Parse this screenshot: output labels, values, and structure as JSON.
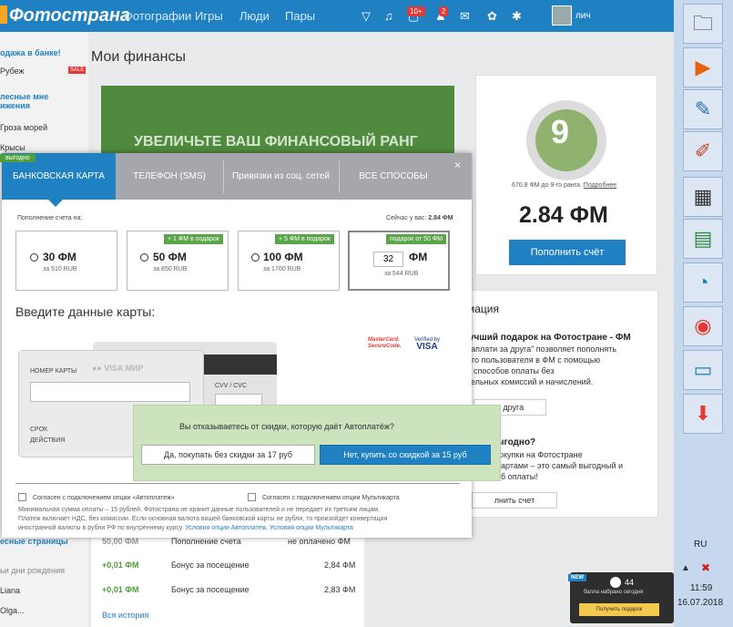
{
  "topbar": {
    "brand": "Фотострана",
    "nav": [
      "Фотографии",
      "Игры",
      "Люди",
      "Пары"
    ],
    "badge_counter": "10+",
    "badge_friends": "2",
    "user_name": "лич"
  },
  "sidebar": {
    "items": [
      "одажа в банке!",
      "Рубеж",
      "лесные мне",
      "ижения",
      "Гроза морей",
      "Крысы",
      "есные страницы",
      "ьи дни рождения",
      "Liana",
      "Olga..."
    ],
    "sale_label": "SALE"
  },
  "page": {
    "title": "Мои финансы",
    "banner_text": "УВЕЛИЧЬТЕ ВАШ ФИНАНСОВЫЙ РАНГ",
    "rank_number": "9",
    "rank_sub": "670.8 ФМ до 9-го ранга.",
    "rank_link": "Подробнее",
    "balance": "2.84 ФМ",
    "topup_button": "Пополнить счёт"
  },
  "info": {
    "title": "мация",
    "gift_title": "учший подарок на Фотостране - ФМ",
    "gift_text_1": "заплати за друга\" позволяет пополнять",
    "gift_text_2": "ого пользователя в ФМ с помощью",
    "gift_text_3": "х способов оплаты без",
    "gift_text_4": "тельных комиссий и начислений.",
    "gift_button": "а друга",
    "q_title": "ыгодно?",
    "q_text_1": "окупки на Фотостране",
    "q_text_2": "артами – это самый выгодный и",
    "q_text_3": "б оплаты!",
    "q_button": "лнить счет"
  },
  "history": {
    "rows": [
      {
        "amount": "50,00 ФМ",
        "desc": "Пополнение счета",
        "status": "не оплачено ФМ"
      },
      {
        "amount": "+0,01 ФМ",
        "desc": "Бонус за посещение",
        "status": "2,84 ФМ"
      },
      {
        "amount": "+0,01 ФМ",
        "desc": "Бонус за посещение",
        "status": "2,83 ФМ"
      }
    ],
    "all_link": "Вся история"
  },
  "modal": {
    "tag": "выгодно",
    "tabs": [
      "БАНКОВСКАЯ КАРТА",
      "ТЕЛЕФОН (SMS)",
      "Привязки из соц. сетей",
      "ВСЕ СПОСОБЫ"
    ],
    "close": "×",
    "topup_label": "Пополнение счета на:",
    "have_label": "Сейчас у вас:",
    "have_value": "2.84 ФМ",
    "options": [
      {
        "amount": "30 ФМ",
        "rub": "за 510 RUB",
        "bonus": ""
      },
      {
        "amount": "50 ФМ",
        "rub": "за 850 RUB",
        "bonus": "+ 1 ФМ в подарок"
      },
      {
        "amount": "100 ФМ",
        "rub": "за 1700 RUB",
        "bonus": "+ 5 ФМ в подарок"
      },
      {
        "amount": "ФМ",
        "rub": "за 544 RUB",
        "bonus": "подарок от 50 ФМ",
        "input_value": "32"
      }
    ],
    "enter_title": "Введите данные карты:",
    "mastercard": "MasterCard. SecureCode.",
    "visa_top": "Verified by",
    "visa_main": "VISA",
    "card_logos": "VISA МИР",
    "card_number_label": "НОМЕР КАРТЫ",
    "cvv_label": "CVV / CVC",
    "expiry_label": "СРОК ДЕЙСТВИЯ",
    "agree_auto": "Согласен с подключением опции «Автоплатеж»",
    "agree_multi": "Согласен с подключением опции Мультикарта",
    "fine_1": "Минимальная сумма оплаты – 15 рублей. Фотострана не хранит данные пользователей и не передает их третьим лицам.",
    "fine_2": "Платеж включает НДС, без комиссии. Если основная валюта вашей банковской карты не рубли, то произойдет конвертация",
    "fine_3": "иностранной валюты в рубли РФ по внутреннему курсу.",
    "fine_link_1": "Условия опции Автоплатеж.",
    "fine_link_2": "Условия опции Мультикарта"
  },
  "confirm": {
    "question": "Вы отказываетесь от скидки, которую даёт Автоплатёж?",
    "no_button": "Да, покупать без скидки за 17 руб",
    "yes_button": "Нет, купить со скидкой за 15 руб"
  },
  "notification": {
    "new": "NEW",
    "count": "44",
    "text": "балла набрано сегодня",
    "button": "Получить подарок"
  },
  "taskbar": {
    "lang": "RU",
    "time": "11:59",
    "date": "16.07.2018"
  }
}
